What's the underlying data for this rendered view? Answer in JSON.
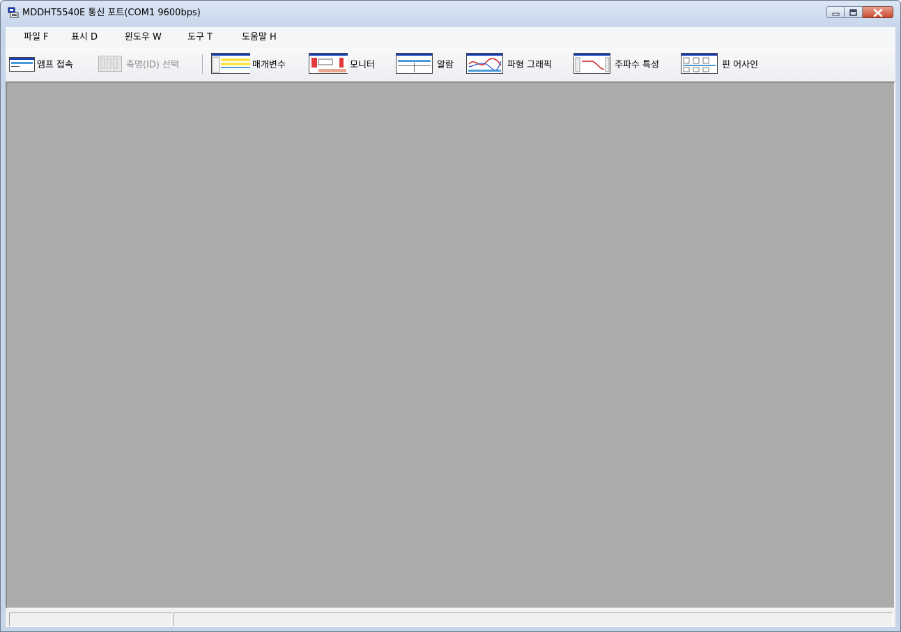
{
  "window": {
    "title": "MDDHT5540E  통신 포트(COM1 9600bps)",
    "controls": [
      "minimize-icon",
      "maximize-icon",
      "close-icon"
    ]
  },
  "menu": {
    "items": [
      {
        "label": "파일 F"
      },
      {
        "label": "표시 D"
      },
      {
        "label": "윈도우 W"
      },
      {
        "label": "도구 T"
      },
      {
        "label": "도움말 H"
      }
    ]
  },
  "toolbar": {
    "buttons": [
      {
        "label": "앰프 접속",
        "icon": "amp-connect-icon",
        "enabled": true
      },
      {
        "label": "축명(ID) 선택",
        "icon": "axis-id-select-icon",
        "enabled": false
      },
      {
        "label": "매개변수",
        "icon": "parameter-icon",
        "enabled": true
      },
      {
        "label": "모니터",
        "icon": "monitor-icon",
        "enabled": true
      },
      {
        "label": "알람",
        "icon": "alarm-icon",
        "enabled": true
      },
      {
        "label": "파형 그래픽",
        "icon": "waveform-graphic-icon",
        "enabled": true
      },
      {
        "label": "주파수 특성",
        "icon": "frequency-characteristic-icon",
        "enabled": true
      },
      {
        "label": "핀 어사인",
        "icon": "pin-assign-icon",
        "enabled": true
      }
    ]
  },
  "mdi_area": {
    "background": "#ababab"
  },
  "statusbar": {
    "panes": [
      "",
      ""
    ]
  },
  "colors": {
    "accent": "#1a3fb5",
    "frame": "#c6d5ea",
    "close": "#c84a2f"
  }
}
